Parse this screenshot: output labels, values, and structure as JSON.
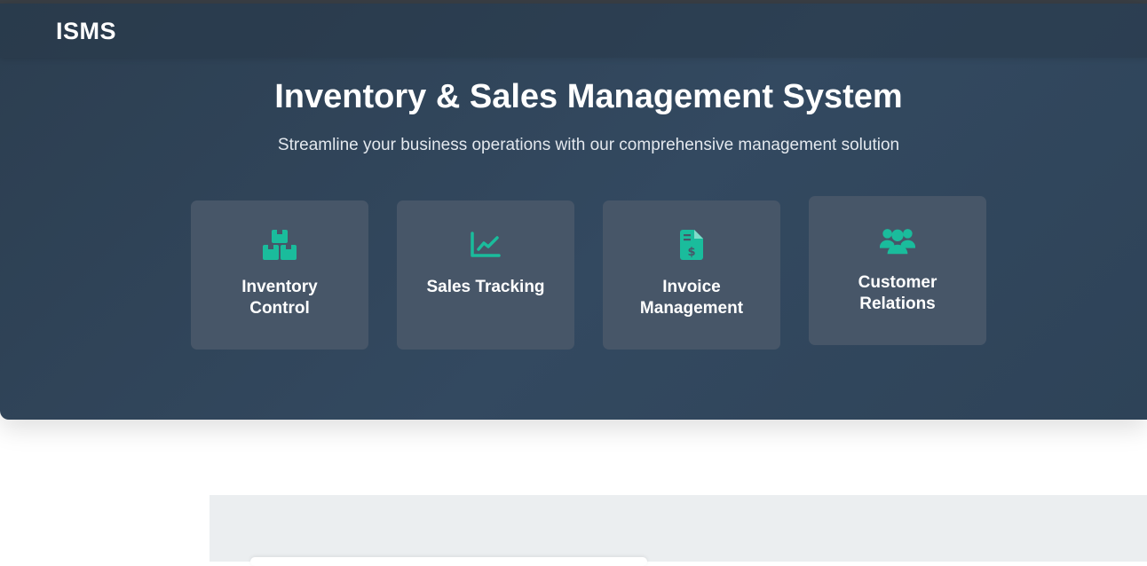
{
  "navbar": {
    "brand": "ISMS"
  },
  "hero": {
    "title": "Inventory & Sales Management System",
    "subtitle": "Streamline your business operations with our comprehensive management solution"
  },
  "colors": {
    "accent": "#1abc9c",
    "hero_bg": "#2c3e50",
    "card_bg": "#475668"
  },
  "features": [
    {
      "label": "Inventory Control",
      "icon": "boxes-icon"
    },
    {
      "label": "Sales Tracking",
      "icon": "chart-line-icon"
    },
    {
      "label": "Invoice Management",
      "icon": "invoice-dollar-icon"
    },
    {
      "label": "Customer Relations",
      "icon": "users-icon"
    }
  ]
}
